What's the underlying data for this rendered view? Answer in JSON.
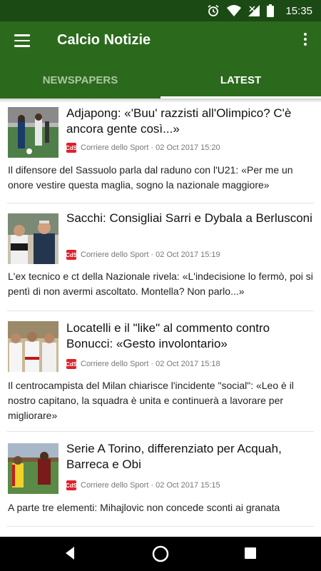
{
  "status_bar": {
    "time": "15:35",
    "icons": [
      "alarm-icon",
      "wifi-icon",
      "signal-icon",
      "battery-icon"
    ]
  },
  "app_bar": {
    "title": "Calcio Notizie"
  },
  "tabs": [
    {
      "label": "NEWSPAPERS",
      "selected": false
    },
    {
      "label": "LATEST",
      "selected": true
    }
  ],
  "articles": [
    {
      "title": "Adjapong: «'Buu' razzisti all'Olimpico? C'è ancora gente così...»",
      "source_logo": "CdS",
      "source": "Corriere dello Sport · 02 Oct 2017 15:20",
      "summary": "Il difensore del Sassuolo parla dal raduno con l'U21: «Per me un onore vestire questa maglia, sogno la nazionale maggiore»"
    },
    {
      "title": "Sacchi: Consigliai Sarri e Dybala a Berlusconi",
      "source_logo": "CdS",
      "source": "Corriere dello Sport · 02 Oct 2017 15:19",
      "summary": "L'ex tecnico e ct della Nazionale rivela: «L'indecisione lo fermò, poi si pentì di non avermi ascoltato. Montella? Non parlo...»"
    },
    {
      "title": "Locatelli e il \"like\" al commento contro Bonucci: «Gesto involontario»",
      "source_logo": "CdS",
      "source": "Corriere dello Sport · 02 Oct 2017 15:18",
      "summary": "Il centrocampista del Milan chiarisce l'incidente \"social\": «Leo è il nostro capitano, la squadra è unita e continuerà a lavorare per migliorare»"
    },
    {
      "title": "Serie A Torino, differenziato per Acquah, Barreca e Obi",
      "source_logo": "CdS",
      "source": "Corriere dello Sport · 02 Oct 2017 15:15",
      "summary": "A parte tre elementi: Mihajlovic non concede sconti ai granata"
    }
  ],
  "nav_bar": {
    "buttons": [
      "back-icon",
      "home-icon",
      "recents-icon"
    ]
  },
  "colors": {
    "status_bar": "#1b4a14",
    "primary": "#2b6a1c",
    "tab_inactive": "#a9c9a0",
    "source_logo": "#e0212b"
  }
}
